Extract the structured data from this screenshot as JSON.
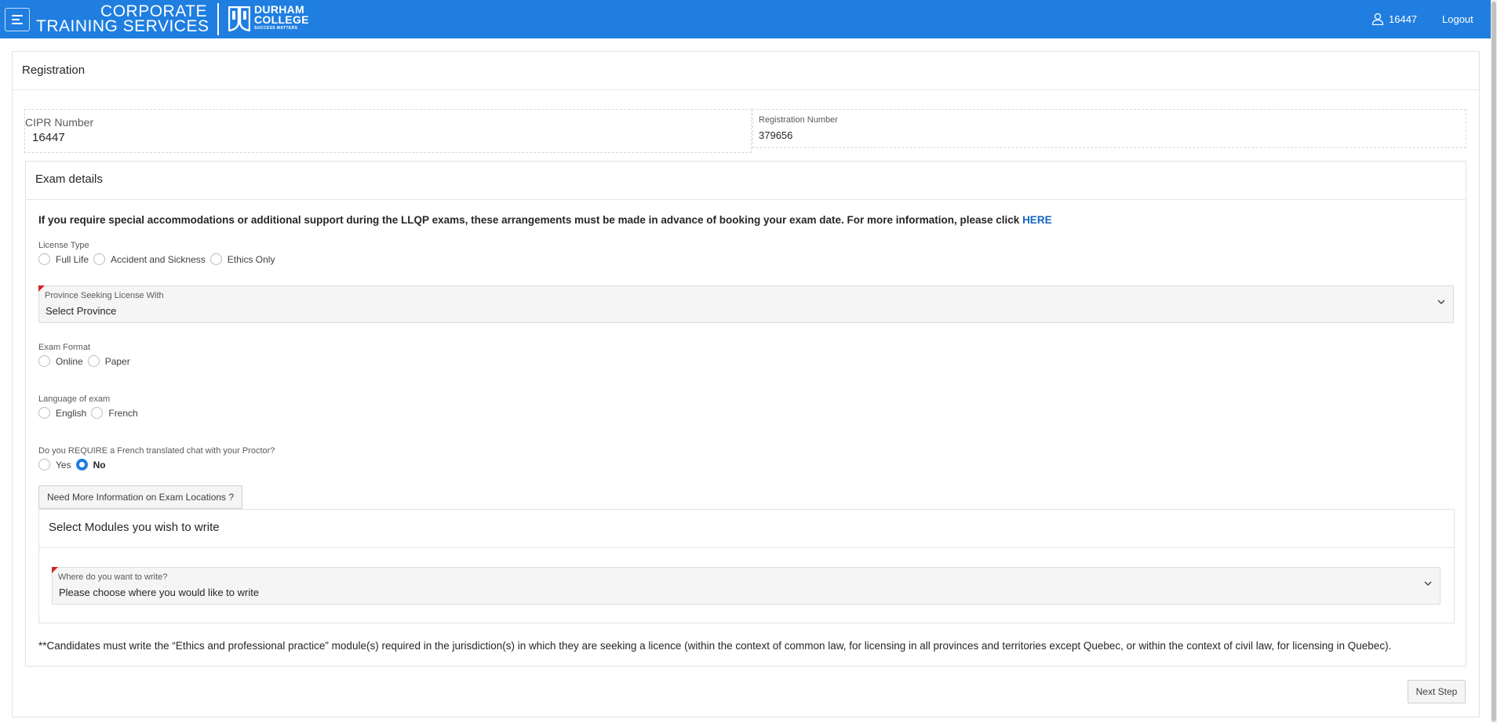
{
  "header": {
    "logo_line1": "CORPORATE",
    "logo_line2": "TRAINING SERVICES",
    "college_line1": "DURHAM",
    "college_line2": "COLLEGE",
    "college_tagline": "SUCCESS MATTERS",
    "user_id": "16447",
    "logout_label": "Logout",
    "menu_icon": "hamburger-menu-icon",
    "user_icon": "user-icon",
    "bar_color": "#1f7ee0"
  },
  "registration": {
    "title": "Registration",
    "cipr_label": "CIPR Number",
    "cipr_value": "16447",
    "reg_number_label": "Registration Number",
    "reg_number_value": "379656"
  },
  "exam_details": {
    "title": "Exam details",
    "notice_text": "If you require special accommodations or additional support during the LLQP exams, these arrangements must be made in advance of booking your exam date. For more information, please click ",
    "notice_link": "HERE",
    "license_type": {
      "label": "License Type",
      "options": [
        "Full Life",
        "Accident and Sickness",
        "Ethics Only"
      ]
    },
    "province": {
      "label": "Province Seeking License With",
      "value": "Select Province"
    },
    "exam_format": {
      "label": "Exam Format",
      "options": [
        "Online",
        "Paper"
      ]
    },
    "language": {
      "label": "Language of exam",
      "options": [
        "English",
        "French"
      ]
    },
    "french_chat": {
      "label": "Do you REQUIRE a French translated chat with your Proctor?",
      "options": [
        "Yes",
        "No"
      ],
      "selected": "No"
    },
    "info_button_label": "Need More Information on Exam Locations ?",
    "modules": {
      "title": "Select Modules you wish to write",
      "where_label": "Where do you want to write?",
      "where_value": "Please choose where you would like to write"
    },
    "footnote": "**Candidates must write the “Ethics and professional practice” module(s) required in the jurisdiction(s) in which they are seeking a licence (within the context of common law, for licensing in all provinces and territories except Quebec, or within the context of civil law, for licensing in Quebec)."
  },
  "next_step_label": "Next Step"
}
